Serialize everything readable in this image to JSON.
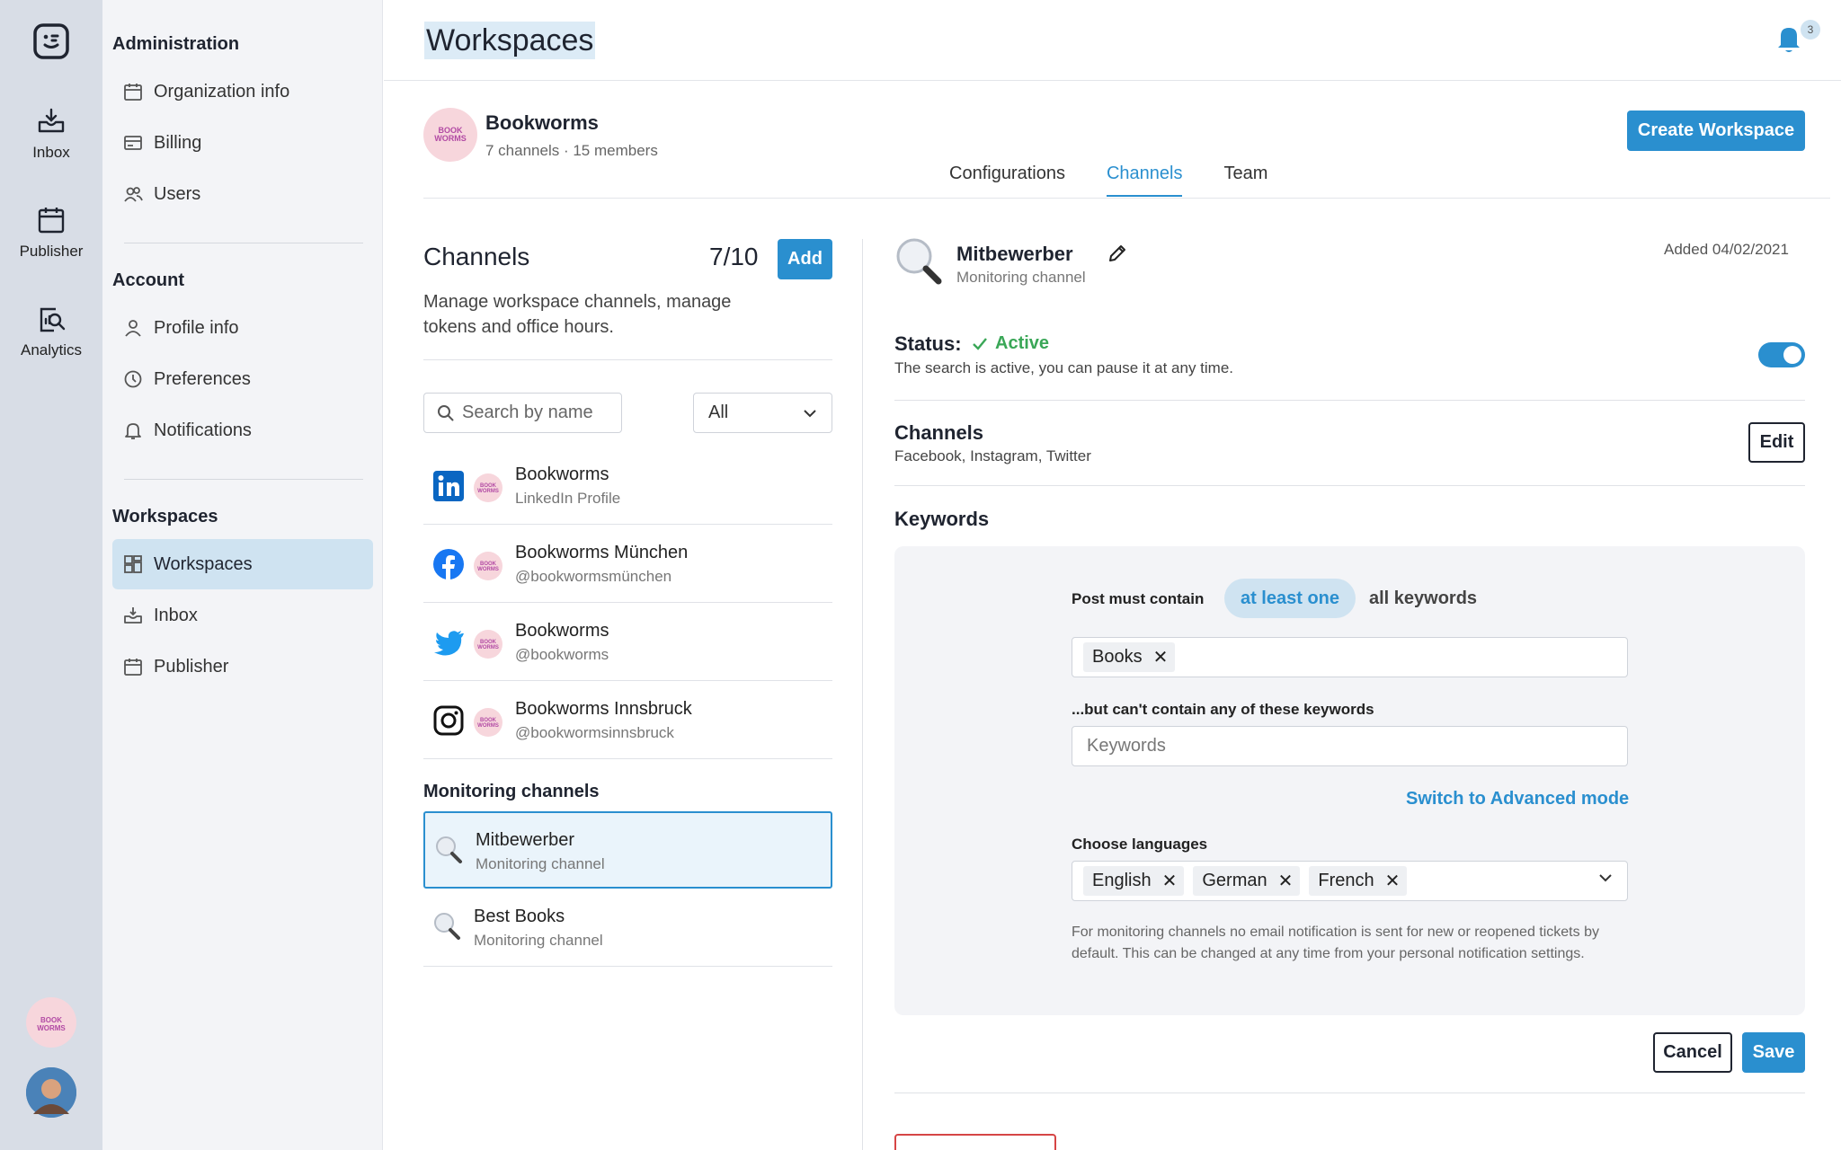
{
  "colors": {
    "accent": "#2a8fcf",
    "success": "#3aa757",
    "danger": "#d64545",
    "rail_bg": "#d8dde6"
  },
  "rail": {
    "items": [
      {
        "label": "Inbox",
        "icon": "inbox-icon"
      },
      {
        "label": "Publisher",
        "icon": "calendar-icon"
      },
      {
        "label": "Analytics",
        "icon": "analytics-icon"
      }
    ]
  },
  "sidebar": {
    "sections": [
      {
        "title": "Administration",
        "items": [
          "Organization info",
          "Billing",
          "Users"
        ]
      },
      {
        "title": "Account",
        "items": [
          "Profile info",
          "Preferences",
          "Notifications"
        ]
      },
      {
        "title": "Workspaces",
        "items": [
          "Workspaces",
          "Inbox",
          "Publisher"
        ]
      }
    ],
    "active_item": "Workspaces"
  },
  "header": {
    "title": "Workspaces",
    "notification_count": "3"
  },
  "workspace": {
    "name": "Bookworms",
    "avatar_text": "BOOK WORMS",
    "meta": "7 channels · 15 members",
    "create_button": "Create Workspace",
    "tabs": [
      {
        "label": "Configurations",
        "active": false
      },
      {
        "label": "Channels",
        "active": true
      },
      {
        "label": "Team",
        "active": false
      }
    ]
  },
  "channels_panel": {
    "title": "Channels",
    "count": "7/10",
    "add_button": "Add",
    "description": "Manage workspace channels, manage tokens and office hours.",
    "search_placeholder": "Search by name",
    "filter_value": "All",
    "channels": [
      {
        "network": "linkedin-icon",
        "name": "Bookworms",
        "sub": "LinkedIn Profile"
      },
      {
        "network": "facebook-icon",
        "name": "Bookworms München",
        "sub": "@bookwormsmünchen"
      },
      {
        "network": "twitter-icon",
        "name": "Bookworms",
        "sub": "@bookworms"
      },
      {
        "network": "instagram-icon",
        "name": "Bookworms Innsbruck",
        "sub": "@bookwormsinnsbruck"
      }
    ],
    "monitoring_title": "Monitoring channels",
    "monitoring": [
      {
        "name": "Mitbewerber",
        "sub": "Monitoring channel",
        "selected": true
      },
      {
        "name": "Best Books",
        "sub": "Monitoring channel",
        "selected": false
      }
    ]
  },
  "detail": {
    "name": "Mitbewerber",
    "sub": "Monitoring channel",
    "added": "Added 04/02/2021",
    "status_label": "Status:",
    "status_value": "Active",
    "status_desc": "The search is active, you can pause it at any time.",
    "status_enabled": true,
    "channels_title": "Channels",
    "channels_list": "Facebook, Instagram, Twitter",
    "edit_button": "Edit",
    "keywords_title": "Keywords",
    "keywords": {
      "must_contain_label": "Post must contain",
      "mode_options": [
        "at least one",
        "all keywords"
      ],
      "mode_selected": "at least one",
      "include": [
        "Books"
      ],
      "exclude_label": "...but can't contain any of these keywords",
      "exclude_placeholder": "Keywords",
      "advanced_link": "Switch to Advanced mode",
      "languages_label": "Choose languages",
      "languages": [
        "English",
        "German",
        "French"
      ],
      "note": "For monitoring channels no email notification is sent for new or reopened tickets by default. This can be changed at any time from your personal notification settings."
    },
    "cancel_button": "Cancel",
    "save_button": "Save"
  }
}
